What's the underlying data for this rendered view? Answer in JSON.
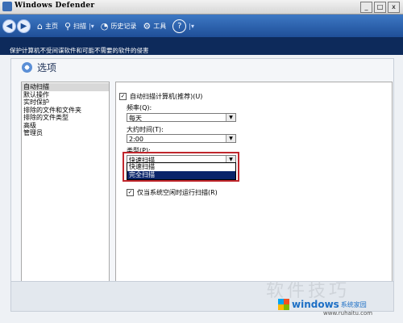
{
  "window": {
    "title": "Windows Defender",
    "min": "_",
    "max": "□",
    "close": "x"
  },
  "toolbar": {
    "home_label": "主页",
    "scan_label": "扫描",
    "history_label": "历史记录",
    "tools_label": "工具",
    "help_symbol": "?"
  },
  "subheader": {
    "text": "保护计算机不受间谍软件和可能不需要的软件的侵害"
  },
  "options": {
    "title": "选项",
    "nav": [
      "自动扫描",
      "默认操作",
      "实时保护",
      "排除的文件和文件夹",
      "排除的文件类型",
      "高级",
      "管理员"
    ],
    "auto_scan_label": "自动扫描计算机(推荐)(U)",
    "frequency_label": "频率(Q):",
    "frequency_value": "每天",
    "time_label": "大约时间(T):",
    "time_value": "2:00",
    "type_label": "类型(P):",
    "type_value": "快速扫描",
    "type_options": [
      "快速扫描",
      "完全扫描"
    ],
    "idle_label": "仅当系统空闲时运行扫描(R)"
  },
  "watermark": {
    "text": "软件技巧"
  },
  "logo": {
    "brand": "windows",
    "cn": "系统家园",
    "url": "www.ruhaitu.com"
  },
  "colors": {
    "toolbar": "#2a5fae",
    "subheader": "#0d2a5b",
    "highlight": "#0a246a",
    "callout": "#c0262c"
  }
}
